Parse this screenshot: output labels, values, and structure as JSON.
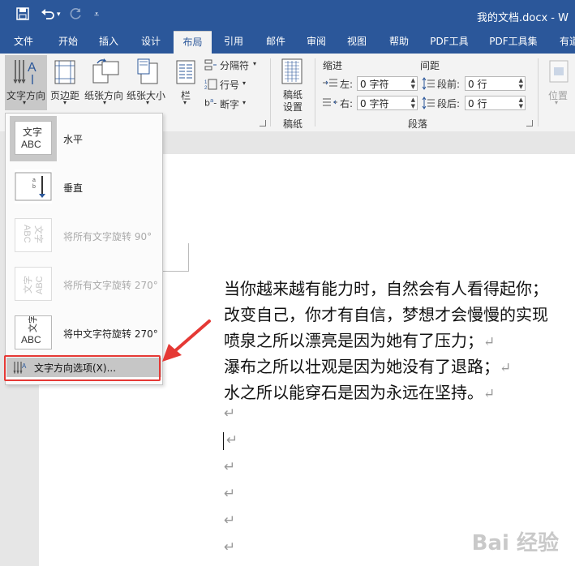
{
  "window": {
    "title": "我的文档.docx - W"
  },
  "quick_access": {
    "save_icon": "save-icon",
    "undo_icon": "undo-icon",
    "redo_icon": "redo-icon",
    "customize_icon": "customize-icon"
  },
  "tabs": [
    {
      "label": "文件"
    },
    {
      "label": "开始"
    },
    {
      "label": "插入"
    },
    {
      "label": "设计"
    },
    {
      "label": "布局",
      "active": true
    },
    {
      "label": "引用"
    },
    {
      "label": "邮件"
    },
    {
      "label": "审阅"
    },
    {
      "label": "视图"
    },
    {
      "label": "帮助"
    },
    {
      "label": "PDF工具"
    },
    {
      "label": "PDF工具集"
    },
    {
      "label": "有道"
    }
  ],
  "ribbon": {
    "page_setup": {
      "text_direction": "文字方向",
      "margins": "页边距",
      "orientation": "纸张方向",
      "size": "纸张大小",
      "columns": "栏",
      "breaks": "分隔符",
      "line_numbers": "行号",
      "hyphenation": "断字"
    },
    "manuscript": {
      "settings_line1": "稿纸",
      "settings_line2": "设置",
      "group": "稿纸"
    },
    "paragraph": {
      "indent_title": "缩进",
      "spacing_title": "间距",
      "left_label": "左:",
      "left_value": "0 字符",
      "right_label": "右:",
      "right_value": "0 字符",
      "before_label": "段前:",
      "before_value": "0 行",
      "after_label": "段后:",
      "after_value": "0 行",
      "group": "段落"
    },
    "arrange": {
      "position": "位置"
    }
  },
  "dropdown": {
    "items": [
      {
        "label": "水平",
        "tile_text": "文字\nABC",
        "enabled": true,
        "selected": true
      },
      {
        "label": "垂直",
        "enabled": true
      },
      {
        "label": "将所有文字旋转 90°",
        "enabled": false
      },
      {
        "label": "将所有文字旋转 270°",
        "enabled": false
      },
      {
        "label": "将中文字符旋转 270°",
        "enabled": true
      }
    ],
    "options": "文字方向选项(X)..."
  },
  "document": {
    "lines": [
      "当你越来越有能力时，自然会有人看得起你；",
      "改变自己，你才有自信，梦想才会慢慢的实现",
      "喷泉之所以漂亮是因为她有了压力；",
      "瀑布之所以壮观是因为她没有了退路；",
      "水之所以能穿石是因为永远在坚持。"
    ],
    "para_mark": "↵"
  },
  "colors": {
    "accent": "#2b579a",
    "highlight": "#e53935"
  },
  "watermark": "Bai 经验"
}
